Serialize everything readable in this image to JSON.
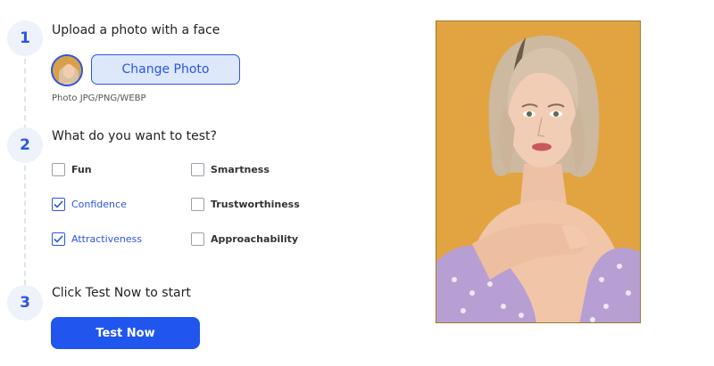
{
  "steps": [
    {
      "number": "1",
      "title": "Upload a photo with a face"
    },
    {
      "number": "2",
      "title": "What do you want to test?"
    },
    {
      "number": "3",
      "title": "Click Test Now to start"
    }
  ],
  "upload": {
    "change_photo_label": "Change Photo",
    "formats_hint": "Photo JPG/PNG/WEBP"
  },
  "options": [
    {
      "label": "Fun",
      "checked": false
    },
    {
      "label": "Smartness",
      "checked": false
    },
    {
      "label": "Confidence",
      "checked": true
    },
    {
      "label": "Trustworthiness",
      "checked": false
    },
    {
      "label": "Attractiveness",
      "checked": true
    },
    {
      "label": "Approachability",
      "checked": false
    }
  ],
  "actions": {
    "test_now_label": "Test Now"
  },
  "colors": {
    "accent": "#2b55e6",
    "button_primary": "#2156ee",
    "button_secondary_bg": "#dde8fb",
    "badge_bg": "#eef2fb",
    "photo_background": "#e5a744"
  }
}
